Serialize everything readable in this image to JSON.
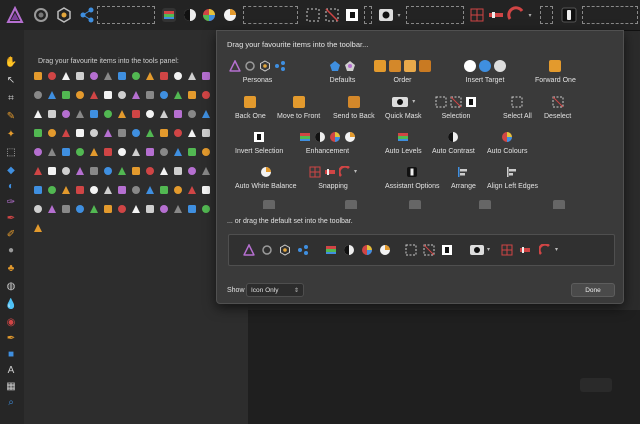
{
  "colors": {
    "accent_purple": "#b56fd0",
    "accent_red": "#d04545",
    "accent_orange": "#e39a2d",
    "accent_blue": "#3f8fe0",
    "toolbar_bg": "#232323",
    "sheet_bg": "#3a3a3a"
  },
  "tools_panel": {
    "heading": "Drag your favourite items into the tools panel:"
  },
  "sheet": {
    "title": "Drag your favourite items into the toolbar...",
    "options": [
      {
        "label": "Personas"
      },
      {
        "label": "Defaults"
      },
      {
        "label": "Order"
      },
      {
        "label": "Insert Target"
      },
      {
        "label": "Forward One"
      },
      {
        "label": "Back One"
      },
      {
        "label": "Move to Front"
      },
      {
        "label": "Send to Back"
      },
      {
        "label": "Quick Mask"
      },
      {
        "label": "Selection"
      },
      {
        "label": "Select All"
      },
      {
        "label": "Deselect"
      },
      {
        "label": "Invert Selection"
      },
      {
        "label": "Enhancement"
      },
      {
        "label": "Auto Levels"
      },
      {
        "label": "Auto Contrast"
      },
      {
        "label": "Auto Colours"
      },
      {
        "label": "Auto White Balance"
      },
      {
        "label": "Snapping"
      },
      {
        "label": "Assistant Options"
      },
      {
        "label": "Arrange"
      },
      {
        "label": "Align Left Edges"
      }
    ],
    "drag_default_heading": "... or drag the default set into the toolbar.",
    "show_label": "Show",
    "show_value": "Icon Only",
    "done_label": "Done"
  }
}
